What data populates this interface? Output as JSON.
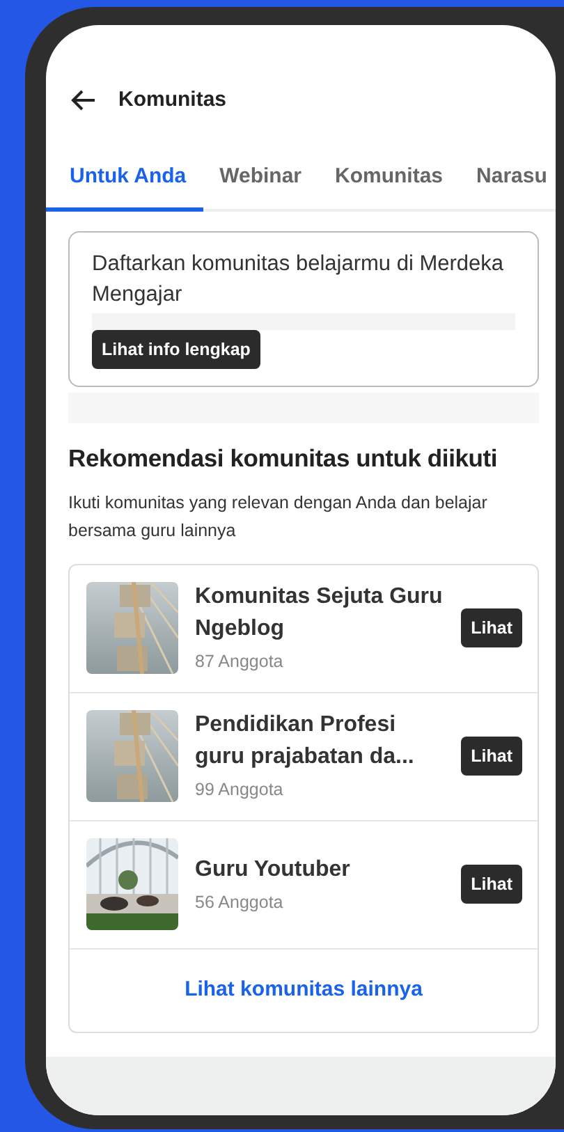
{
  "header": {
    "title": "Komunitas"
  },
  "tabs": [
    {
      "label": "Untuk Anda",
      "selected": true
    },
    {
      "label": "Webinar",
      "selected": false
    },
    {
      "label": "Komunitas",
      "selected": false
    },
    {
      "label": "Narasu",
      "selected": false
    }
  ],
  "banner": {
    "text": "Daftarkan komunitas belajarmu di Merdeka Mengajar",
    "button": "Lihat info lengkap"
  },
  "recommendations": {
    "title": "Rekomendasi komunitas untuk diikuti",
    "subtitle": "Ikuti komunitas yang relevan dengan Anda dan belajar bersama guru lainnya",
    "items": [
      {
        "name": "Komunitas Sejuta Guru Ngeblog",
        "members": "87 Anggota",
        "button": "Lihat"
      },
      {
        "name": "Pendidikan Profesi guru prajabatan da...",
        "members": "99 Anggota",
        "button": "Lihat"
      },
      {
        "name": "Guru Youtuber",
        "members": "56 Anggota",
        "button": "Lihat"
      }
    ],
    "more_link": "Lihat komunitas lainnya"
  }
}
